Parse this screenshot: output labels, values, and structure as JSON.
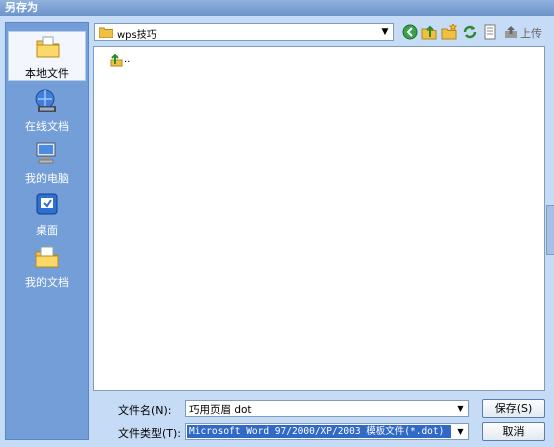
{
  "window": {
    "title": "另存为"
  },
  "places": [
    {
      "label": "本地文件",
      "icon": "local-folder-icon",
      "selected": true
    },
    {
      "label": "在线文档",
      "icon": "online-docs-icon",
      "selected": false
    },
    {
      "label": "我的电脑",
      "icon": "my-computer-icon",
      "selected": false
    },
    {
      "label": "桌面",
      "icon": "desktop-icon",
      "selected": false
    },
    {
      "label": "我的文档",
      "icon": "my-documents-icon",
      "selected": false
    }
  ],
  "toolbar": {
    "location": "wps技巧",
    "upload_label": "上传"
  },
  "filelist": {
    "items": [
      {
        "label": "..",
        "icon": "up-folder-icon"
      }
    ]
  },
  "form": {
    "filename_label": "文件名(N):",
    "filename_value": "巧用页眉 dot",
    "filetype_label": "文件类型(T):",
    "filetype_value": "Microsoft Word 97/2000/XP/2003 模板文件(*.dot)"
  },
  "buttons": {
    "save": "保存(S)",
    "cancel": "取消"
  }
}
